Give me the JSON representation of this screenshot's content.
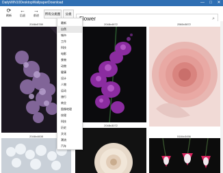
{
  "window": {
    "title": "DailyWIN10DesktopWallpaperDownload",
    "minimize_glyph": "—",
    "maximize_glyph": "□",
    "close_glyph": "✕"
  },
  "toolbar": {
    "items": [
      {
        "label": "刷新",
        "icon": "refresh-icon",
        "glyph": "⟳"
      },
      {
        "label": "后退",
        "icon": "back-arrow-icon",
        "glyph": "←"
      },
      {
        "label": "前进",
        "icon": "forward-arrow-icon",
        "glyph": "→"
      }
    ],
    "buttons": [
      {
        "label": "所有分类图"
      },
      {
        "label": "分类"
      }
    ]
  },
  "search": {
    "value": "Flower",
    "icon": "search-icon",
    "glyph": "⌕"
  },
  "gallery": {
    "top_captions": [
      "2048x5789",
      "2048x4672",
      "2560x3872"
    ],
    "bottom_captions": [
      "2048x4608",
      "",
      "5184x3456"
    ],
    "middle_caption": "2048x3072"
  },
  "category_menu": {
    "items": [
      "最新",
      "自然",
      "城市",
      "工作",
      "科技",
      "电影",
      "食物",
      "动物",
      "健康",
      "设计",
      "人物",
      "运动",
      "旅行",
      "商业",
      "图像地理",
      "纹理",
      "科技",
      "历史",
      "文化",
      "潮流",
      "汽车"
    ],
    "selected_index": 1
  },
  "colors": {
    "titlebar": "#2f6fb3",
    "menu_selected": "#e8e8e8"
  }
}
